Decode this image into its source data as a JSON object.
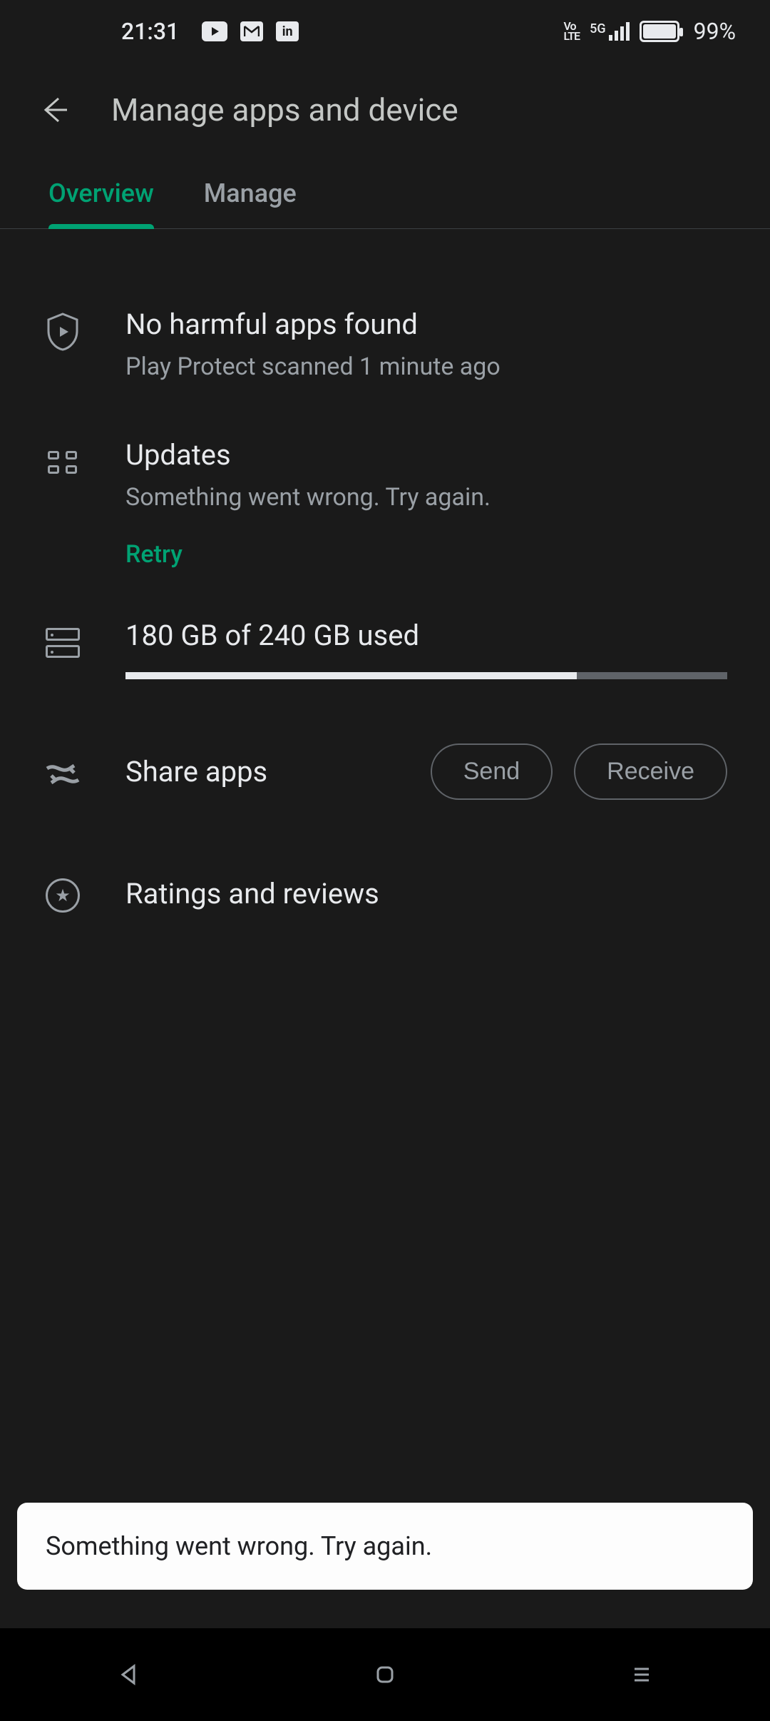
{
  "status": {
    "time": "21:31",
    "battery_pct": "99%",
    "volte": "Vo\nLTE",
    "net": "5G"
  },
  "header": {
    "title": "Manage apps and device"
  },
  "tabs": {
    "overview": "Overview",
    "manage": "Manage"
  },
  "protect": {
    "title": "No harmful apps found",
    "sub": "Play Protect scanned 1 minute ago"
  },
  "updates": {
    "title": "Updates",
    "sub": "Something went wrong. Try again.",
    "retry": "Retry"
  },
  "storage": {
    "title": "180 GB of 240 GB used",
    "used_pct": 75
  },
  "share": {
    "title": "Share apps",
    "send": "Send",
    "receive": "Receive"
  },
  "ratings": {
    "title": "Ratings and reviews"
  },
  "snackbar": {
    "text": "Something went wrong. Try again."
  }
}
